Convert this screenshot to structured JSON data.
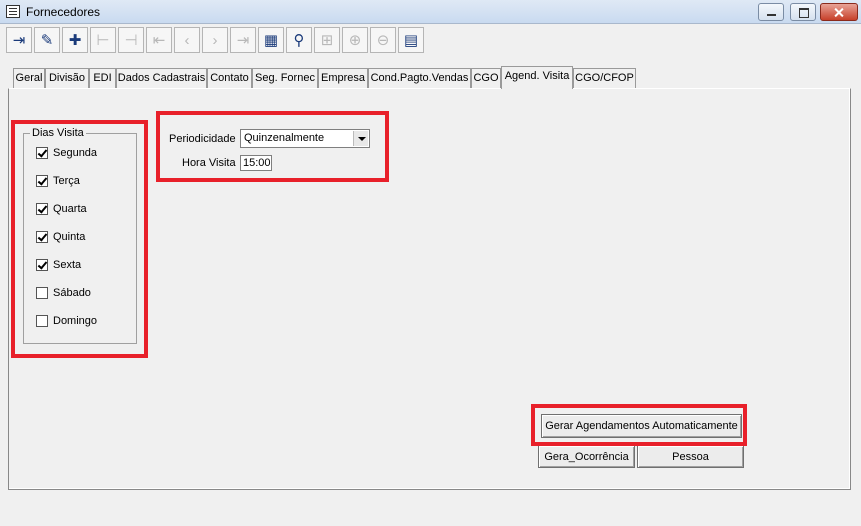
{
  "window": {
    "title": "Fornecedores"
  },
  "toolbar": {
    "buttons": [
      {
        "icon": "exit-door-icon",
        "state": "enabled"
      },
      {
        "icon": "pencil-edit-icon",
        "state": "enabled"
      },
      {
        "icon": "add-record-icon",
        "state": "enabled"
      },
      {
        "icon": "add-child-icon",
        "state": "disabled"
      },
      {
        "icon": "remove-child-icon",
        "state": "disabled"
      },
      {
        "icon": "first-record-icon",
        "state": "disabled"
      },
      {
        "icon": "previous-record-icon",
        "state": "disabled"
      },
      {
        "icon": "next-record-icon",
        "state": "disabled"
      },
      {
        "icon": "last-record-icon",
        "state": "disabled"
      },
      {
        "icon": "grid-view-icon",
        "state": "enabled"
      },
      {
        "icon": "binoculars-search-icon",
        "state": "enabled"
      },
      {
        "icon": "tree-expand-icon",
        "state": "disabled"
      },
      {
        "icon": "tree-insert-icon",
        "state": "disabled"
      },
      {
        "icon": "tree-remove-icon",
        "state": "disabled"
      },
      {
        "icon": "calendar-schedule-icon",
        "state": "enabled"
      }
    ]
  },
  "tabs": [
    {
      "label": "Geral"
    },
    {
      "label": "Divisão"
    },
    {
      "label": "EDI"
    },
    {
      "label": "Dados Cadastrais"
    },
    {
      "label": "Contato"
    },
    {
      "label": "Seg. Fornec"
    },
    {
      "label": "Empresa"
    },
    {
      "label": "Cond.Pagto.Vendas"
    },
    {
      "label": "CGO"
    },
    {
      "label": "Agend. Visita",
      "active": true
    },
    {
      "label": "CGO/CFOP"
    }
  ],
  "dias_visita": {
    "legend": "Dias Visita",
    "items": [
      {
        "label": "Segunda",
        "checked": true
      },
      {
        "label": "Terça",
        "checked": true
      },
      {
        "label": "Quarta",
        "checked": true
      },
      {
        "label": "Quinta",
        "checked": true
      },
      {
        "label": "Sexta",
        "checked": true
      },
      {
        "label": "Sábado",
        "checked": false
      },
      {
        "label": "Domingo",
        "checked": false
      }
    ]
  },
  "form": {
    "periodicidade_label": "Periodicidade",
    "periodicidade_value": "Quinzenalmente",
    "hora_visita_label": "Hora Visita",
    "hora_visita_value": "15:00"
  },
  "actions": {
    "gerar_agendamentos": "Gerar Agendamentos Automaticamente",
    "gera_ocorrencia": "Gera_Ocorrência",
    "pessoa": "Pessoa"
  },
  "colors": {
    "highlight": "#e8202a"
  }
}
